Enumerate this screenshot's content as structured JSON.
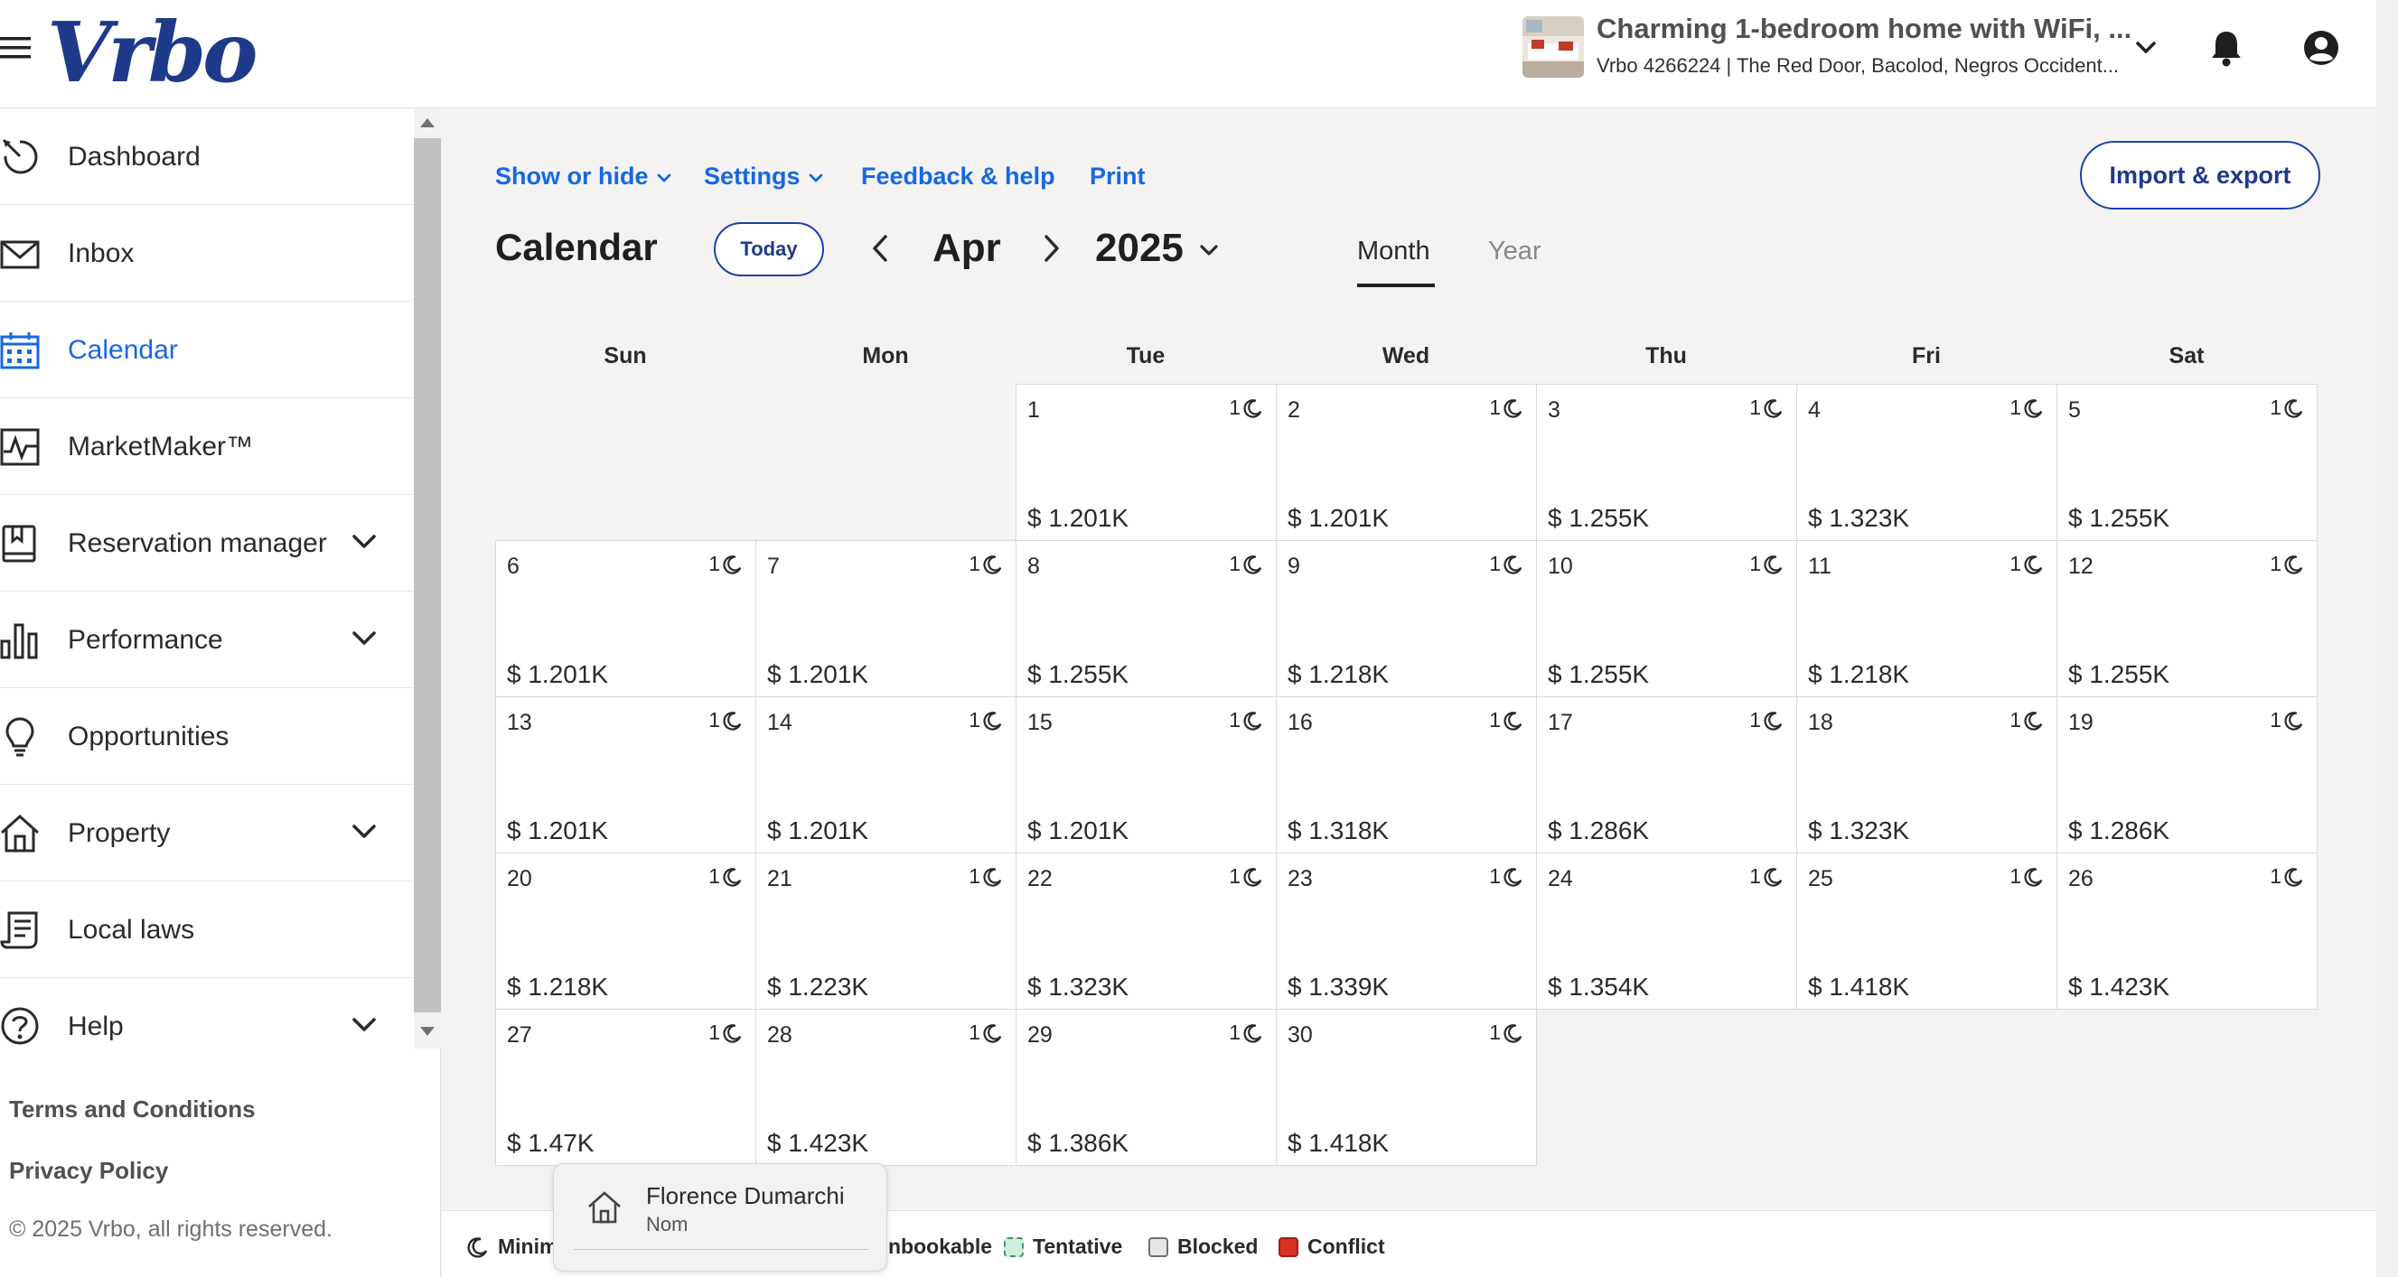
{
  "header": {
    "logo": "Vrbo",
    "property_title": "Charming 1-bedroom home with WiFi, ...",
    "property_subtitle": "Vrbo 4266224 | The Red Door, Bacolod, Negros Occident..."
  },
  "sidebar": {
    "items": [
      {
        "label": "Dashboard",
        "icon": "dashboard-icon"
      },
      {
        "label": "Inbox",
        "icon": "envelope-icon"
      },
      {
        "label": "Calendar",
        "icon": "calendar-icon",
        "active": true
      },
      {
        "label": "MarketMaker™",
        "icon": "activity-icon"
      },
      {
        "label": "Reservation manager",
        "icon": "book-icon",
        "expandable": true
      },
      {
        "label": "Performance",
        "icon": "bar-chart-icon",
        "expandable": true
      },
      {
        "label": "Opportunities",
        "icon": "lightbulb-icon"
      },
      {
        "label": "Property",
        "icon": "house-icon",
        "expandable": true
      },
      {
        "label": "Local laws",
        "icon": "scroll-icon"
      },
      {
        "label": "Help",
        "icon": "question-icon",
        "expandable": true
      }
    ],
    "terms": "Terms and Conditions",
    "privacy": "Privacy Policy",
    "copyright": "© 2025 Vrbo, all rights reserved."
  },
  "toolbar": {
    "show_hide": "Show or hide",
    "settings": "Settings",
    "feedback": "Feedback & help",
    "print": "Print",
    "import_export": "Import & export"
  },
  "calendar": {
    "title": "Calendar",
    "today": "Today",
    "month": "Apr",
    "year": "2025",
    "tabs": [
      "Month",
      "Year"
    ],
    "weekdays": [
      "Sun",
      "Mon",
      "Tue",
      "Wed",
      "Thu",
      "Fri",
      "Sat"
    ],
    "first_weekday_index": 2,
    "min_nights": "1",
    "days": [
      {
        "day": "1",
        "price": "$ 1.201K"
      },
      {
        "day": "2",
        "price": "$ 1.201K"
      },
      {
        "day": "3",
        "price": "$ 1.255K"
      },
      {
        "day": "4",
        "price": "$ 1.323K"
      },
      {
        "day": "5",
        "price": "$ 1.255K"
      },
      {
        "day": "6",
        "price": "$ 1.201K"
      },
      {
        "day": "7",
        "price": "$ 1.201K"
      },
      {
        "day": "8",
        "price": "$ 1.255K"
      },
      {
        "day": "9",
        "price": "$ 1.218K"
      },
      {
        "day": "10",
        "price": "$ 1.255K"
      },
      {
        "day": "11",
        "price": "$ 1.218K"
      },
      {
        "day": "12",
        "price": "$ 1.255K"
      },
      {
        "day": "13",
        "price": "$ 1.201K"
      },
      {
        "day": "14",
        "price": "$ 1.201K"
      },
      {
        "day": "15",
        "price": "$ 1.201K"
      },
      {
        "day": "16",
        "price": "$ 1.318K"
      },
      {
        "day": "17",
        "price": "$ 1.286K"
      },
      {
        "day": "18",
        "price": "$ 1.323K"
      },
      {
        "day": "19",
        "price": "$ 1.286K"
      },
      {
        "day": "20",
        "price": "$ 1.218K"
      },
      {
        "day": "21",
        "price": "$ 1.223K"
      },
      {
        "day": "22",
        "price": "$ 1.323K"
      },
      {
        "day": "23",
        "price": "$ 1.339K"
      },
      {
        "day": "24",
        "price": "$ 1.354K"
      },
      {
        "day": "25",
        "price": "$ 1.418K"
      },
      {
        "day": "26",
        "price": "$ 1.423K"
      },
      {
        "day": "27",
        "price": "$ 1.47K"
      },
      {
        "day": "28",
        "price": "$ 1.423K"
      },
      {
        "day": "29",
        "price": "$ 1.386K"
      },
      {
        "day": "30",
        "price": "$ 1.418K"
      }
    ]
  },
  "legend": {
    "minimum": "Minim",
    "unbookable": "nbookable",
    "tentative": "Tentative",
    "blocked": "Blocked",
    "conflict": "Conflict",
    "colors": {
      "tentative": "#8fd19e",
      "blocked": "#e6e6e6",
      "conflict": "#d93025"
    }
  },
  "popup": {
    "name": "Florence Dumarchi",
    "subtitle": "Nom"
  },
  "colors": {
    "accent": "#1668e3",
    "brand": "#1e3a8a"
  }
}
